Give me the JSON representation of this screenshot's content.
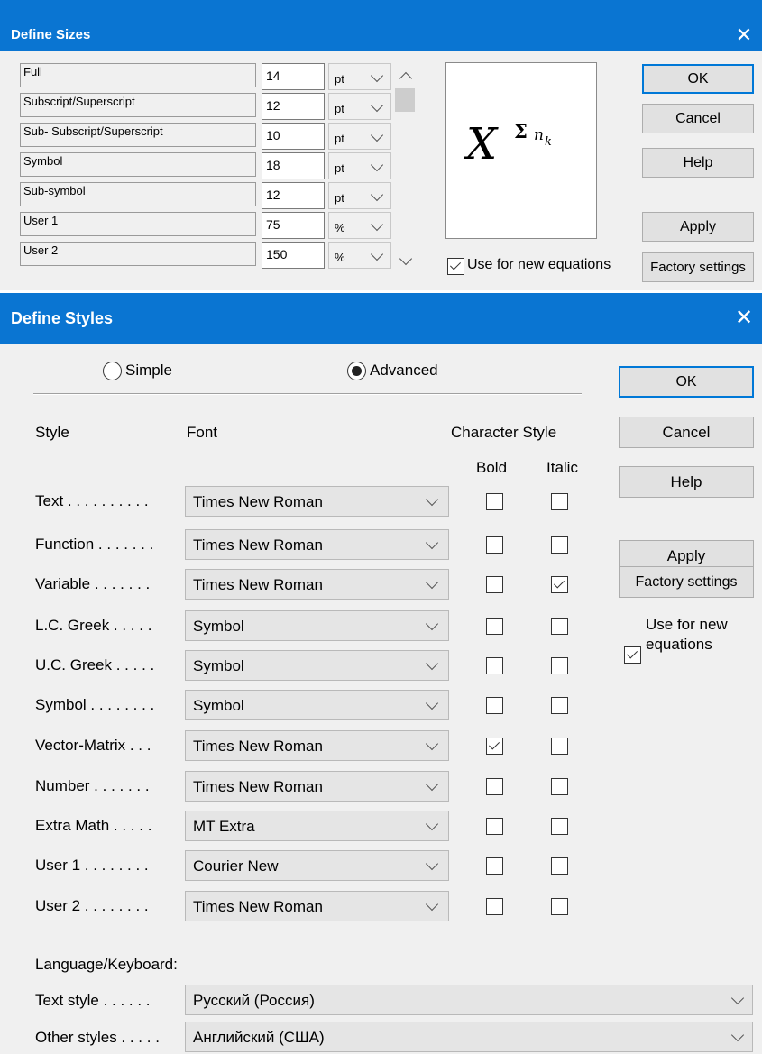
{
  "define_sizes": {
    "title": "Define Sizes",
    "close_icon": "✕",
    "rows": [
      {
        "label": "Full",
        "value": "14",
        "unit": "pt"
      },
      {
        "label": "Subscript/Superscript",
        "value": "12",
        "unit": "pt"
      },
      {
        "label": "Sub- Subscript/Superscript",
        "value": "10",
        "unit": "pt"
      },
      {
        "label": "Symbol",
        "value": "18",
        "unit": "pt"
      },
      {
        "label": "Sub-symbol",
        "value": "12",
        "unit": "pt"
      },
      {
        "label": "User 1",
        "value": "75",
        "unit": "%"
      },
      {
        "label": "User 2",
        "value": "150",
        "unit": "%"
      }
    ],
    "preview": {
      "base": "X",
      "sup": "Σ",
      "sup2": "n",
      "sub": "k"
    },
    "use_for_new_label": "Use for new equations",
    "use_for_new_checked": true,
    "buttons": {
      "ok": "OK",
      "cancel": "Cancel",
      "help": "Help",
      "apply": "Apply",
      "factory": "Factory settings"
    }
  },
  "define_styles": {
    "title": "Define Styles",
    "close_icon": "✕",
    "mode_simple": "Simple",
    "mode_advanced": "Advanced",
    "selected_mode": "Advanced",
    "col_style": "Style",
    "col_font": "Font",
    "col_char_style": "Character Style",
    "col_bold": "Bold",
    "col_italic": "Italic",
    "rows": [
      {
        "label": "Text . . . . . . . . . .",
        "font": "Times New Roman",
        "bold": false,
        "italic": false
      },
      {
        "label": "Function . . . . . . .",
        "font": "Times New Roman",
        "bold": false,
        "italic": false
      },
      {
        "label": "Variable . . . . . . .",
        "font": "Times New Roman",
        "bold": false,
        "italic": true
      },
      {
        "label": "L.C. Greek . . . . .",
        "font": "Symbol",
        "bold": false,
        "italic": false
      },
      {
        "label": "U.C. Greek . . . . .",
        "font": "Symbol",
        "bold": false,
        "italic": false
      },
      {
        "label": "Symbol . . . . . . . .",
        "font": "Symbol",
        "bold": false,
        "italic": false
      },
      {
        "label": "Vector-Matrix . . .",
        "font": "Times New Roman",
        "bold": true,
        "italic": false
      },
      {
        "label": "Number . . . . . . .",
        "font": "Times New Roman",
        "bold": false,
        "italic": false
      },
      {
        "label": "Extra Math . . . . .",
        "font": "MT Extra",
        "bold": false,
        "italic": false
      },
      {
        "label": "User 1 . . . . . . . .",
        "font": "Courier New",
        "bold": false,
        "italic": false
      },
      {
        "label": "User 2 . . . . . . . .",
        "font": "Times New Roman",
        "bold": false,
        "italic": false
      }
    ],
    "language_heading": "Language/Keyboard:",
    "text_style_label": "Text style . . . . . .",
    "text_style_value": "Русский (Россия)",
    "other_styles_label": "Other styles . . . . .",
    "other_styles_value": "Английский (США)",
    "use_for_new_label_1": "Use for new",
    "use_for_new_label_2": "equations",
    "use_for_new_checked": true,
    "buttons": {
      "ok": "OK",
      "cancel": "Cancel",
      "help": "Help",
      "apply": "Apply",
      "factory": "Factory settings"
    }
  }
}
